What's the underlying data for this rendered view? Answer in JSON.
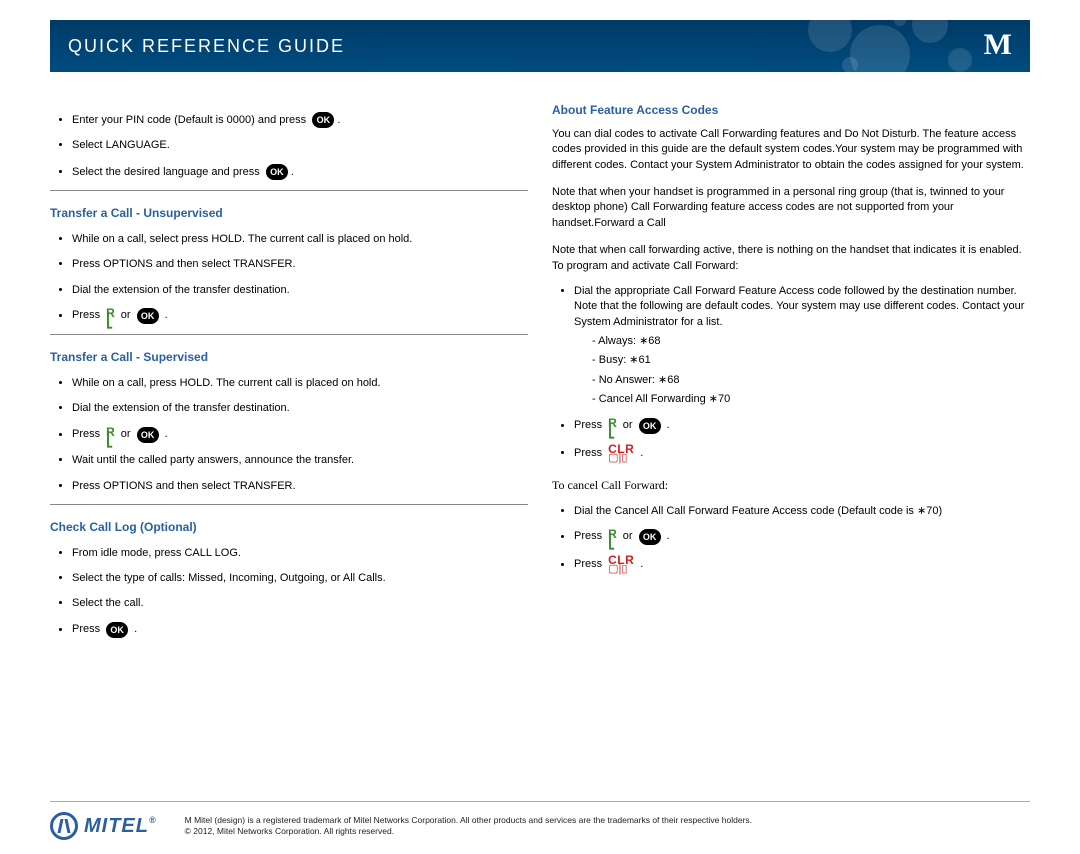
{
  "header": {
    "title": "Quick Reference Guide"
  },
  "icons": {
    "ok": "OK",
    "clr": "CLR",
    "clr_sym": "▢|▯"
  },
  "left": {
    "intro": [
      "Enter your PIN code (Default is 0000) and press",
      "Select LANGUAGE.",
      "Select the desired language and press"
    ],
    "s1_title": "Transfer a Call - Unsupervised",
    "s1": [
      "While on a call, select press HOLD. The current call is placed on hold.",
      "Press OPTIONS and then select TRANSFER.",
      "Dial the extension of the transfer destination."
    ],
    "press": "Press",
    "or": "or",
    "s2_title": "Transfer a Call - Supervised",
    "s2": [
      "While on a call, press HOLD. The current call is placed on hold.",
      "Dial the extension of the transfer destination."
    ],
    "s2b": [
      "Wait until the called party answers, announce the transfer.",
      "Press OPTIONS and then select TRANSFER."
    ],
    "s3_title": "Check Call Log  (Optional)",
    "s3": [
      "From idle mode, press CALL LOG.",
      "Select the type of calls: Missed, Incoming, Outgoing, or All Calls.",
      "Select the call."
    ]
  },
  "right": {
    "title": "About Feature Access Codes",
    "p1": "You can dial codes to activate Call Forwarding features and Do Not Disturb. The feature access codes provided in this guide are the default system codes.Your system may be programmed with different codes. Contact your System Administrator to obtain the codes assigned for your system.",
    "p2": "Note that when your handset is programmed in a personal ring group (that is, twinned to your desktop phone) Call Forwarding feature access codes are not supported from your handset.Forward a Call",
    "p3": "Note that when call forwarding active, there is nothing on the handset that indicates it is enabled. To program and activate Call Forward:",
    "dial": "Dial the appropriate Call Forward Feature Access code followed by the destination number. Note that the following are default codes. Your system may use different codes. Contact your System Administrator for a list.",
    "codes": [
      "Always: ∗68",
      "Busy: ∗61",
      "No Answer: ∗68",
      "Cancel All Forwarding ∗70"
    ],
    "cancel_head": "To cancel Call Forward:",
    "cancel_dial": "Dial the Cancel All Call Forward Feature Access code (Default code is ∗70)"
  },
  "footer": {
    "brand": "MITEL",
    "line1": "M Mitel (design) is a registered trademark of Mitel Networks Corporation. All other products and services are the trademarks of their respective holders.",
    "line2": "© 2012, Mitel Networks Corporation. All rights reserved."
  }
}
